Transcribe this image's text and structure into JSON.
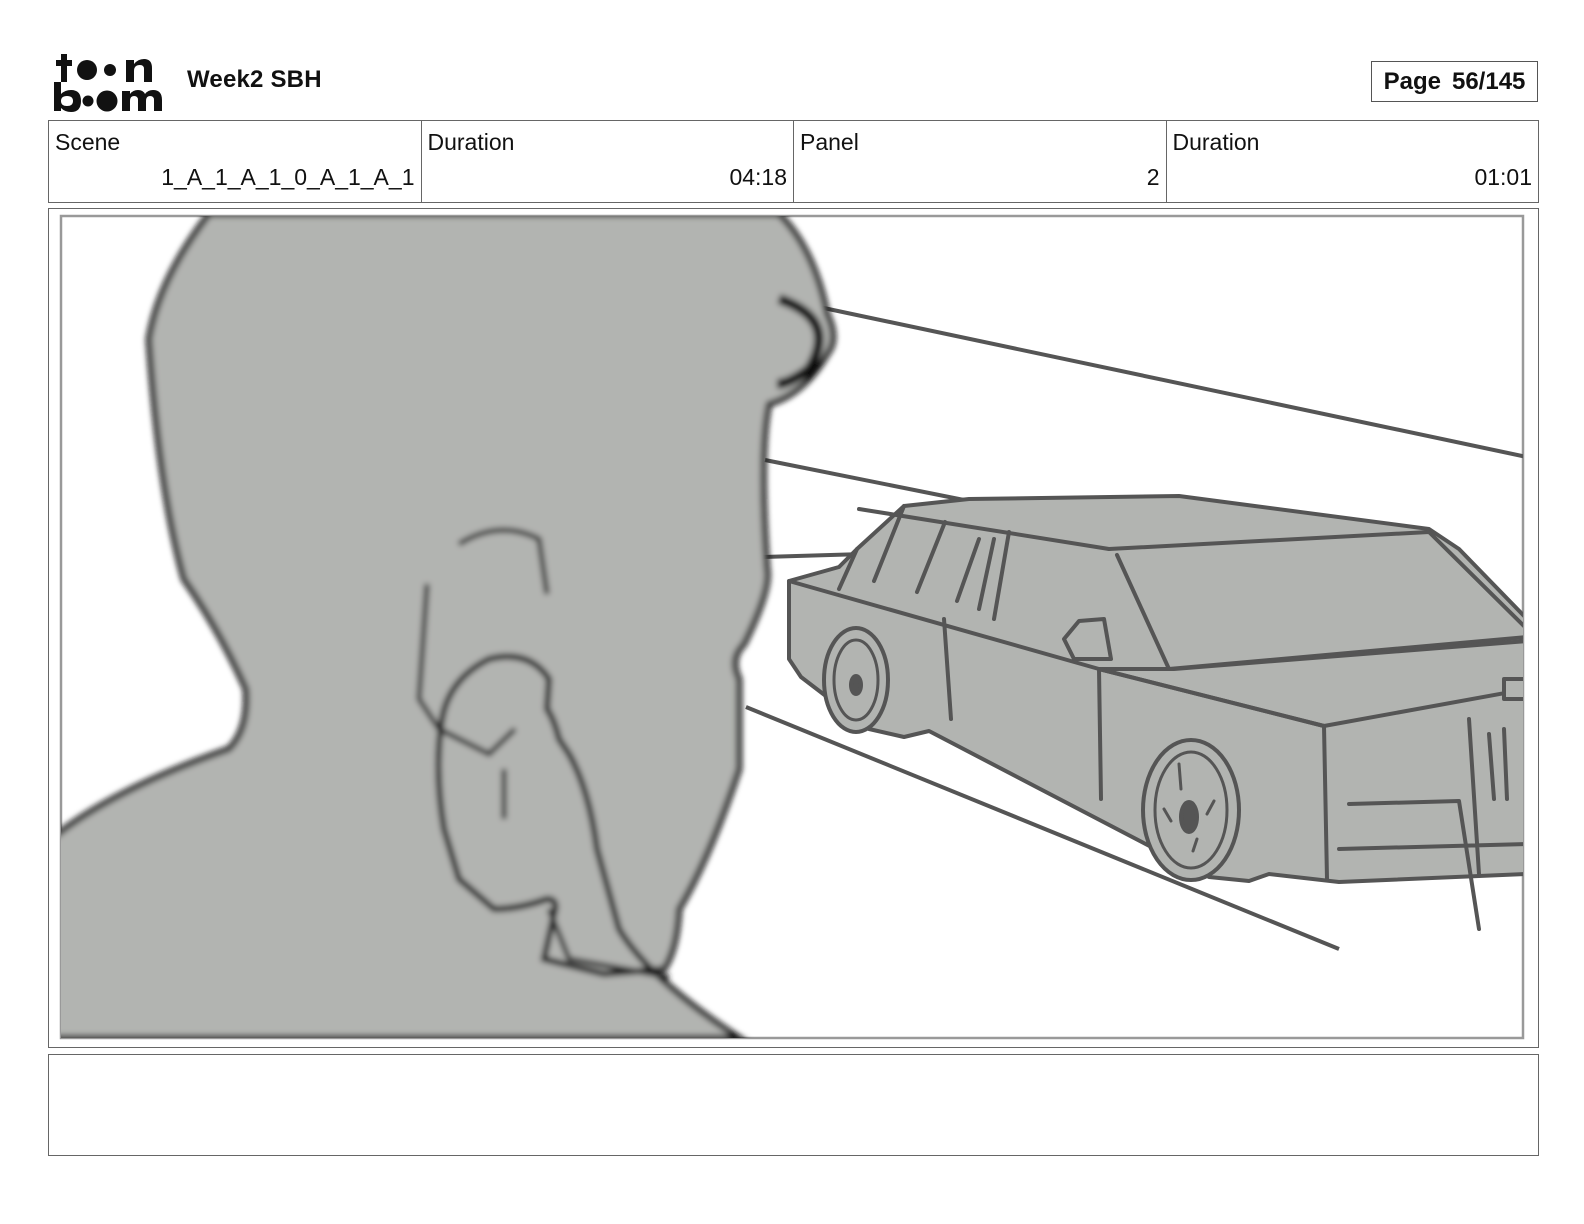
{
  "header": {
    "logo_name": "toon-boom-logo",
    "title": "Week2 SBH",
    "page_label": "Page",
    "page_value": "56/145"
  },
  "info": {
    "scene_label": "Scene",
    "scene_value": "1_A_1_A_1_0_A_1_A_1",
    "scene_duration_label": "Duration",
    "scene_duration_value": "04:18",
    "panel_label": "Panel",
    "panel_value": "2",
    "panel_duration_label": "Duration",
    "panel_duration_value": "01:01"
  },
  "notes": {
    "text": ""
  }
}
